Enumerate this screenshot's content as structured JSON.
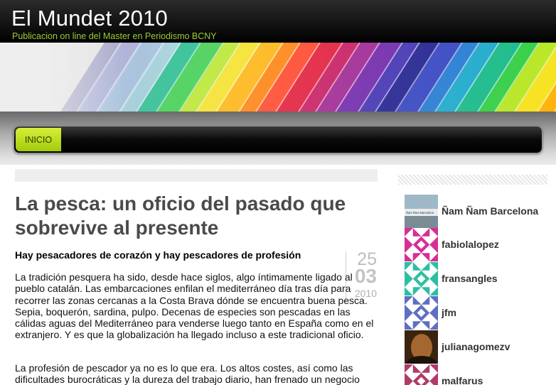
{
  "site": {
    "title": "El Mundet 2010",
    "description": "Publicacion on line del Master en Periodismo BCNY"
  },
  "nav": {
    "items": [
      {
        "label": "INICIO",
        "active": true
      }
    ]
  },
  "post": {
    "title": "La pesca: un oficio del pasado que sobrevive al presente",
    "lead": "Hay pesacadores de corazón y hay pescadores de profesión",
    "date": {
      "day": "25",
      "month": "03",
      "year": "2010"
    },
    "paragraphs": [
      "La tradición pesquera ha sido, desde hace siglos, algo íntimamente ligado al pueblo catalán. Las embarcaciones enfilan el mediterráneo día tras día para recorrer las zonas cercanas a la Costa Brava dónde se encuentra buena pesca. Sepia, boquerón, sardina, pulpo. Decenas de especies son pescadas en las cálidas aguas del Mediterráneo para venderse luego tanto en España como en el extranjero. Y es que la globalización ha llegado incluso a este tradicional oficio.",
      "La profesión de pescador ya no es lo que era. Los altos costes, así como las dificultades burocráticas y la dureza del trabajo diario, han frenado un negocio"
    ]
  },
  "sidebar": {
    "authors": [
      {
        "name": "Ñam Ñam Barcelona",
        "avatar": "photo-avatar-icon",
        "avatar_caption": "Ñam Ñam Barcelona",
        "colors": [
          "#9fb8c8",
          "#e8edf0"
        ]
      },
      {
        "name": "fabiolalopez",
        "avatar": "identicon-avatar-icon",
        "colors": [
          "#d62f95",
          "#ffffff"
        ]
      },
      {
        "name": "fransangles",
        "avatar": "identicon-avatar-icon",
        "colors": [
          "#2bbfa1",
          "#ffffff"
        ]
      },
      {
        "name": "jfm",
        "avatar": "identicon-avatar-icon",
        "colors": [
          "#5d6fc4",
          "#ffffff"
        ]
      },
      {
        "name": "julianagomezv",
        "avatar": "photo-avatar-icon",
        "colors": [
          "#3a2410",
          "#c07838"
        ]
      },
      {
        "name": "malfarus",
        "avatar": "identicon-avatar-icon",
        "colors": [
          "#b03a6a",
          "#ffffff"
        ]
      }
    ]
  },
  "colors": {
    "accent": "#a2cc0c",
    "header_bg": "#000000",
    "title_text": "#4a4a4a"
  }
}
